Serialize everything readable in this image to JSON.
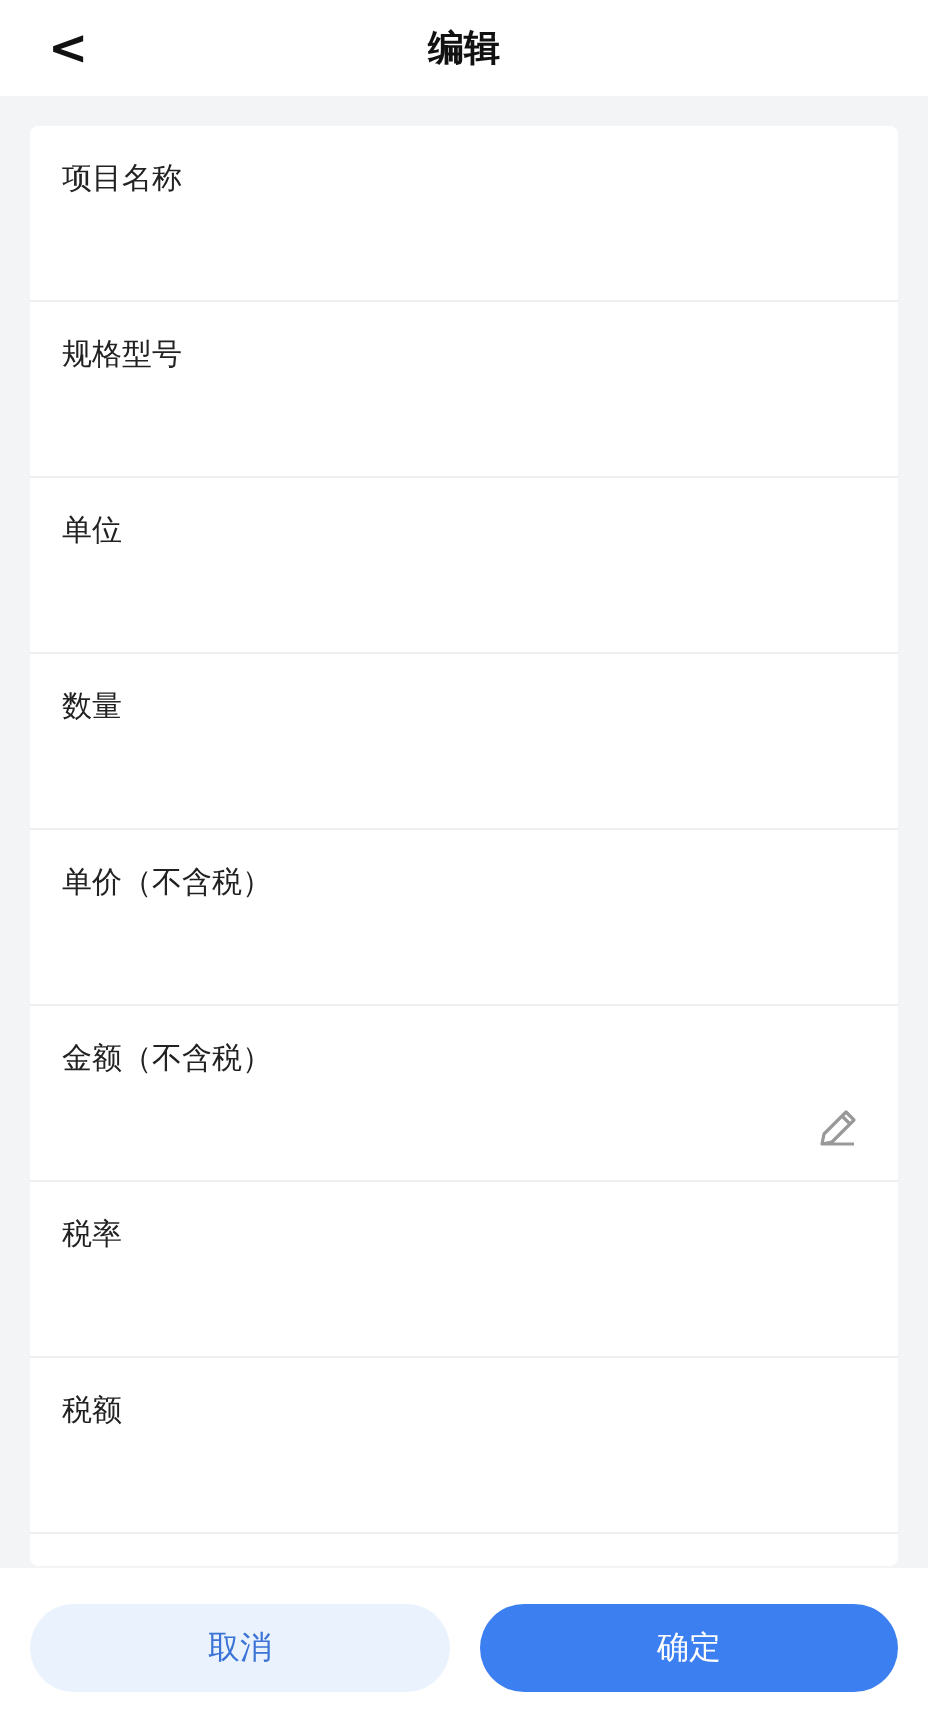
{
  "header": {
    "back": "<",
    "title": "编辑"
  },
  "fields": [
    {
      "label": "项目名称",
      "editable": false
    },
    {
      "label": "规格型号",
      "editable": false
    },
    {
      "label": "单位",
      "editable": false
    },
    {
      "label": "数量",
      "editable": false
    },
    {
      "label": "单价（不含税）",
      "editable": false
    },
    {
      "label": "金额（不含税）",
      "editable": true
    },
    {
      "label": "税率",
      "editable": false
    },
    {
      "label": "税额",
      "editable": false
    }
  ],
  "buttons": [
    {
      "label": "取消",
      "kind": "secondary"
    },
    {
      "label": "确定",
      "kind": "primary"
    }
  ]
}
